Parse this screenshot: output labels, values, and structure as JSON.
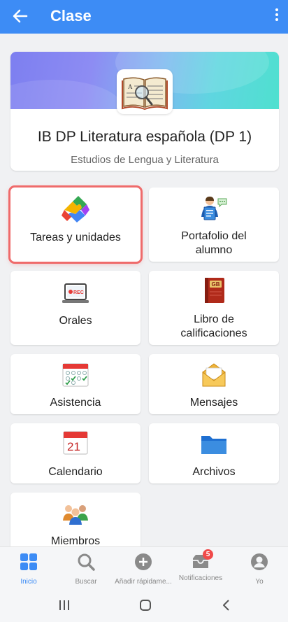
{
  "appbar": {
    "title": "Clase"
  },
  "course": {
    "title": "IB DP Literatura española (DP 1)",
    "subtitle": "Estudios de Lengua y Literatura"
  },
  "tiles": [
    {
      "label_line1": "Tareas y unidades",
      "label_line2": "",
      "icon": "puzzle-icon"
    },
    {
      "label_line1": "Portafolio del",
      "label_line2": "alumno",
      "icon": "portfolio-icon"
    },
    {
      "label_line1": "Orales",
      "label_line2": "",
      "icon": "rec-laptop-icon"
    },
    {
      "label_line1": "Libro de",
      "label_line2": "calificaciones",
      "icon": "gradebook-icon"
    },
    {
      "label_line1": "Asistencia",
      "label_line2": "",
      "icon": "attendance-icon"
    },
    {
      "label_line1": "Mensajes",
      "label_line2": "",
      "icon": "envelope-icon"
    },
    {
      "label_line1": "Calendario",
      "label_line2": "",
      "icon": "calendar-icon"
    },
    {
      "label_line1": "Archivos",
      "label_line2": "",
      "icon": "folder-icon"
    },
    {
      "label_line1": "Miembros",
      "label_line2": "",
      "icon": "members-icon"
    }
  ],
  "icon_text": {
    "rec": "REC",
    "gb": "GB",
    "calendar_day": "21"
  },
  "bottom_nav": [
    {
      "label": "Inicio",
      "icon": "grid-icon",
      "active": true
    },
    {
      "label": "Buscar",
      "icon": "search-icon",
      "active": false
    },
    {
      "label": "Añadir rápidame...",
      "icon": "add-icon",
      "active": false
    },
    {
      "label": "Notificaciones",
      "icon": "inbox-icon",
      "active": false,
      "badge": "5"
    },
    {
      "label": "Yo",
      "icon": "profile-icon",
      "active": false
    }
  ],
  "colors": {
    "primary": "#3d8cf5",
    "selection": "#ef6b6b",
    "badge": "#f04a4a"
  }
}
